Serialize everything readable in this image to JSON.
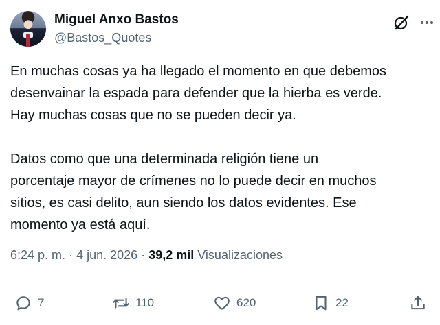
{
  "author": {
    "name": "Miguel Anxo Bastos",
    "handle": "@Bastos_Quotes"
  },
  "header_icons": [
    "grok-icon",
    "more-icon"
  ],
  "tweet": {
    "text": "En muchas cosas ya ha llegado el momento en que debemos\ndesenvainar la espada para defender que la hierba es verde.\nHay muchas cosas que no se pueden decir ya.\n\nDatos como que una determinada religión tiene un\nporcentaje mayor de crímenes no lo puede decir en muchos\nsitios, es casi delito, aun siendo los datos evidentes. Ese\nmomento ya está aquí."
  },
  "meta": {
    "time": "6:24 p. m.",
    "separator": "·",
    "date": "4 jun. 2026",
    "views_count": "39,2 mil",
    "views_label": "Visualizaciones"
  },
  "actions": {
    "replies": {
      "icon": "reply-icon",
      "count": "7"
    },
    "reposts": {
      "icon": "repost-icon",
      "count": "110"
    },
    "likes": {
      "icon": "like-icon",
      "count": "620"
    },
    "bookmarks": {
      "icon": "bookmark-icon",
      "count": "22"
    },
    "share": {
      "icon": "share-icon"
    }
  },
  "colors": {
    "text": "#0f1419",
    "secondary": "#536471",
    "divider": "#eff3f4"
  }
}
